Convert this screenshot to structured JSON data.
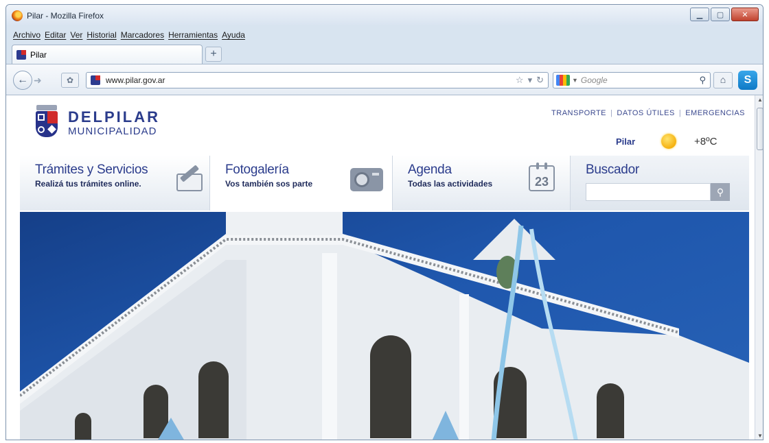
{
  "window": {
    "title": "Pilar - Mozilla Firefox",
    "controls": [
      "minimize",
      "maximize",
      "close"
    ]
  },
  "menu": [
    "Archivo",
    "Editar",
    "Ver",
    "Historial",
    "Marcadores",
    "Herramientas",
    "Ayuda"
  ],
  "tabs": [
    {
      "label": "Pilar",
      "icon": "pilar-favicon"
    }
  ],
  "navbar": {
    "url": "www.pilar.gov.ar",
    "search_engine": "Google",
    "search_placeholder": "Google",
    "icons": [
      "back-arrow-icon",
      "forward-arrow-icon",
      "puzzle-icon",
      "star-icon",
      "dropdown-icon",
      "reload-icon",
      "search-icon",
      "home-icon",
      "skype-icon"
    ]
  },
  "site": {
    "logo_line1": "DELPILAR",
    "logo_line2": "MUNICIPALIDAD",
    "top_links": [
      "TRANSPORTE",
      "DATOS ÚTILES",
      "EMERGENCIAS"
    ],
    "weather": {
      "city": "Pilar",
      "temperature": "+8ºC",
      "condition_icon": "sun-icon"
    },
    "services": [
      {
        "title": "Trámites y Servicios",
        "subtitle": "Realizá tus trámites online.",
        "icon": "form-pencil-icon"
      },
      {
        "title": "Fotogalería",
        "subtitle": "Vos también sos parte",
        "icon": "camera-icon"
      },
      {
        "title": "Agenda",
        "subtitle": "Todas las actividades",
        "icon": "calendar-icon",
        "icon_text": "23"
      },
      {
        "title": "Buscador",
        "input_value": "",
        "icon": "search-icon"
      }
    ]
  },
  "colors": {
    "brand": "#2b3c8c",
    "sky": "#1f57ad",
    "frame": "#d8e4f0"
  }
}
